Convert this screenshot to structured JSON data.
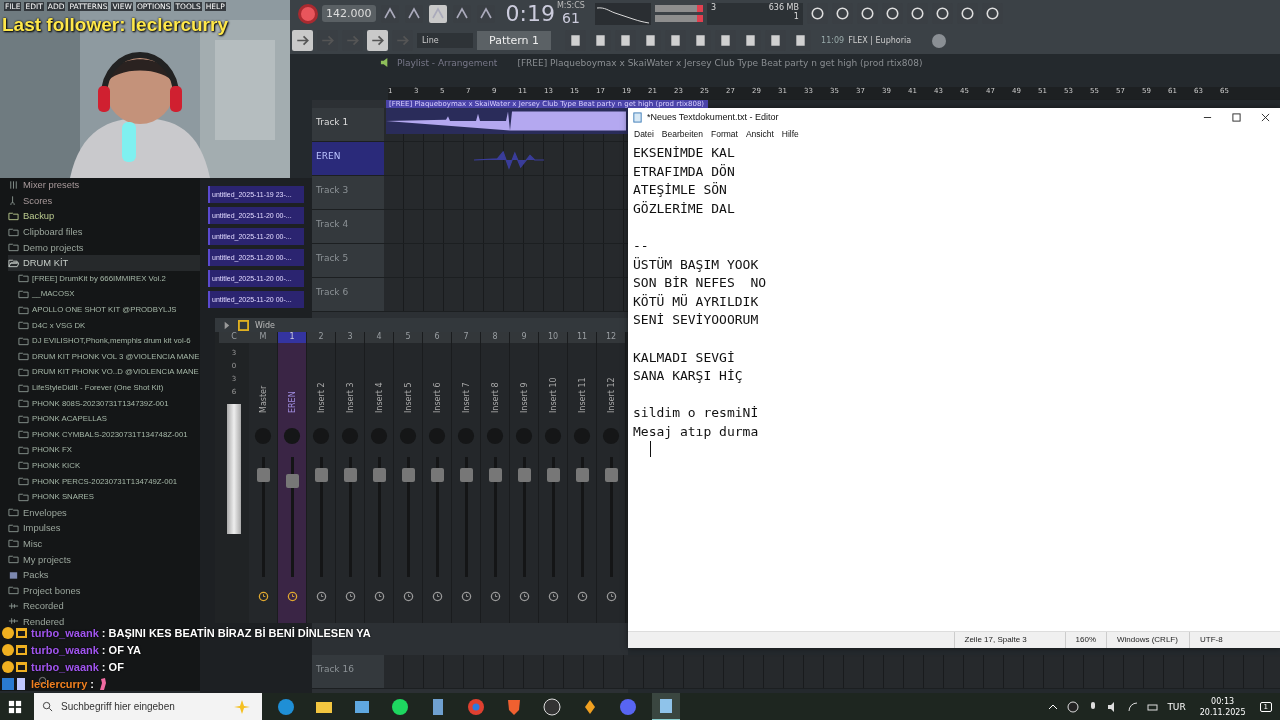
{
  "overlay": {
    "follower": "Last follower: leclercurry"
  },
  "menu": [
    "FILE",
    "EDIT",
    "ADD",
    "PATTERNS",
    "VIEW",
    "OPTIONS",
    "TOOLS",
    "HELP"
  ],
  "toolbar": {
    "tempo": "142.000",
    "time": "0:19",
    "time_cs": "61",
    "time_format": "M:S:CS",
    "cpu": "3",
    "memory": "636 MB",
    "polyphony": "1",
    "snap": "Line",
    "pattern": "Pattern 1",
    "news_time": "11:09",
    "news": "FLEX | Euphoria"
  },
  "playlist": {
    "title": "Playlist - Arrangement",
    "song": "[FREE] Plaqueboymax x SkaiWater x Jersey Club Type Beat party n get high (prod rtix808)",
    "ruler": [
      "1",
      "3",
      "5",
      "7",
      "9",
      "11",
      "13",
      "15",
      "17",
      "19",
      "21",
      "23",
      "25",
      "27",
      "29",
      "31",
      "33",
      "35",
      "37",
      "39",
      "41",
      "43",
      "45",
      "47",
      "49",
      "51",
      "53",
      "55",
      "57",
      "59",
      "61",
      "63",
      "65"
    ],
    "clip": "[FREE] Plaqueboymax x SkaiWater x Jersey Club Type Beat party n get high (prod rtix808)",
    "tracks": [
      {
        "name": "Track 1",
        "selected": false,
        "kind": "audio"
      },
      {
        "name": "EREN",
        "selected": true,
        "kind": "recording"
      },
      {
        "name": "Track 3",
        "selected": false,
        "kind": "empty"
      },
      {
        "name": "Track 4",
        "selected": false,
        "kind": "empty"
      },
      {
        "name": "Track 5",
        "selected": false,
        "kind": "empty"
      },
      {
        "name": "Track 6",
        "selected": false,
        "kind": "empty"
      }
    ],
    "lower_track": "Track 16"
  },
  "patterns": [
    "untitled_2025-11-19 23-...",
    "untitled_2025-11-20 00-...",
    "untitled_2025-11-20 00-...",
    "untitled_2025-11-20 00-...",
    "untitled_2025-11-20 00-...",
    "untitled_2025-11-20 00-..."
  ],
  "browser": {
    "items": [
      {
        "label": "Mixer presets",
        "kind": "mixer",
        "selected": false
      },
      {
        "label": "Scores",
        "kind": "score",
        "selected": false
      },
      {
        "label": "Backup",
        "kind": "backup",
        "selected": false
      },
      {
        "label": "Clipboard files",
        "kind": "folder",
        "selected": false
      },
      {
        "label": "Demo projects",
        "kind": "folder",
        "selected": false
      },
      {
        "label": "DRUM KİT",
        "kind": "folder",
        "selected": true,
        "expanded": true,
        "children": [
          {
            "label": "[FREE] DrumKit by 666IMMIREX Vol.2"
          },
          {
            "label": "__MACOSX"
          },
          {
            "label": "APOLLO ONE SHOT KIT @PRODBYLJS"
          },
          {
            "label": "D4C x VSG DK"
          },
          {
            "label": "DJ EVILISHOT,Phonk,memphis drum kit vol-6"
          },
          {
            "label": "DRUM KIT PHONK VOL 3 @VIOLENCIA MANE"
          },
          {
            "label": "DRUM KIT PHONK VO..D @VIOLENCIA MANE"
          },
          {
            "label": "LifeStyleDidIt - Forever (One Shot Kit)"
          },
          {
            "label": "PHONK 808S-20230731T134739Z-001"
          },
          {
            "label": "PHONK ACAPELLAS"
          },
          {
            "label": "PHONK CYMBALS-20230731T134748Z-001"
          },
          {
            "label": "PHONK FX"
          },
          {
            "label": "PHONK KICK"
          },
          {
            "label": "PHONK PERCS-20230731T134749Z-001"
          },
          {
            "label": "PHONK SNARES"
          }
        ]
      },
      {
        "label": "Envelopes",
        "kind": "folder",
        "selected": false
      },
      {
        "label": "Impulses",
        "kind": "folder",
        "selected": false
      },
      {
        "label": "Misc",
        "kind": "folder",
        "selected": false
      },
      {
        "label": "My projects",
        "kind": "folder",
        "selected": false
      },
      {
        "label": "Packs",
        "kind": "packs",
        "selected": false
      },
      {
        "label": "Project bones",
        "kind": "folder",
        "selected": false
      },
      {
        "label": "Recorded",
        "kind": "recorded",
        "selected": false
      },
      {
        "label": "Rendered",
        "kind": "rendered",
        "selected": false
      }
    ]
  },
  "mixer": {
    "mode": "Wide",
    "meter_header": "C",
    "scale": [
      "3",
      "0",
      "3",
      "6"
    ],
    "strips": [
      {
        "number": "M",
        "label": "Master",
        "selected": false,
        "level": 0.85
      },
      {
        "number": "1",
        "label": "EREN",
        "selected": true,
        "level": 0.8
      },
      {
        "number": "2",
        "label": "Insert 2",
        "selected": false,
        "level": 0.85
      },
      {
        "number": "3",
        "label": "Insert 3",
        "selected": false,
        "level": 0.85
      },
      {
        "number": "4",
        "label": "Insert 4",
        "selected": false,
        "level": 0.85
      },
      {
        "number": "5",
        "label": "Insert 5",
        "selected": false,
        "level": 0.85
      },
      {
        "number": "6",
        "label": "Insert 6",
        "selected": false,
        "level": 0.85
      },
      {
        "number": "7",
        "label": "Insert 7",
        "selected": false,
        "level": 0.85
      },
      {
        "number": "8",
        "label": "Insert 8",
        "selected": false,
        "level": 0.85
      },
      {
        "number": "9",
        "label": "Insert 9",
        "selected": false,
        "level": 0.85
      },
      {
        "number": "10",
        "label": "Insert 10",
        "selected": false,
        "level": 0.85
      },
      {
        "number": "11",
        "label": "Insert 11",
        "selected": false,
        "level": 0.85
      },
      {
        "number": "12",
        "label": "Insert 12",
        "selected": false,
        "level": 0.85
      }
    ]
  },
  "notepad": {
    "title": "*Neues Textdokument.txt - Editor",
    "menu": [
      "Datei",
      "Bearbeiten",
      "Format",
      "Ansicht",
      "Hilfe"
    ],
    "text": "EKSENİMDE KAL\nETRAFIMDA DÖN\nATEŞİMLE SÖN\nGÖZLERİME DAL\n\n--\nÜSTÜM BAŞIM YOOK\nSON BİR NEFES  NO\nKÖTÜ MÜ AYRILDIK\nSENİ SEVİYOOORUM\n\nKALMADI SEVGİ\nSANA KARŞI HİÇ\n\nsildim o resmiNİ\nMesaj atıp durma",
    "status": [
      "Zeile 17, Spalte 3",
      "160%",
      "Windows (CRLF)",
      "UTF-8"
    ]
  },
  "chat": [
    {
      "user": "turbo_waank",
      "kind": "viewer",
      "text": ": BAŞINI KES BEATİN BİRAZ Bİ BENİ DİNLESEN YA"
    },
    {
      "user": "turbo_waank",
      "kind": "viewer",
      "text": ": OF YA"
    },
    {
      "user": "turbo_waank",
      "kind": "viewer",
      "text": ": OF"
    },
    {
      "user": "leclercurry",
      "kind": "broadcaster",
      "text": ":"
    }
  ],
  "taskbar": {
    "search_placeholder": "Suchbegriff hier eingeben",
    "language": "TUR",
    "time": "00:13",
    "date": "20.11.2025",
    "notifications": "1"
  }
}
